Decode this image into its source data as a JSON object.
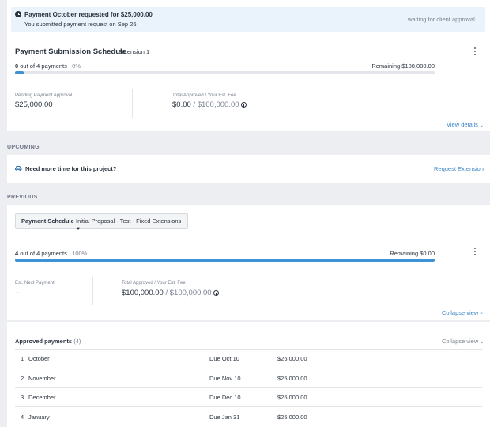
{
  "banner": {
    "title": "Payment October requested for $25,000.00",
    "subtitle": "You submitted payment request on Sep 26",
    "status": "waiting for client approval..."
  },
  "schedule": {
    "title": "Payment Submission Schedule",
    "extension": "Extension 1",
    "count_bold": "0",
    "count_rest": "out of 4 payments",
    "percent": "0%",
    "progress": 0.02,
    "remaining": "Remaining $100,000.00",
    "pending_label": "Pending Payment Approval",
    "pending_value": "$25,000.00",
    "total_label": "Total Approved / Your Est. Fee",
    "total_approved": "$0.00",
    "total_sep": "/",
    "total_fee": "$100,000.00",
    "view_details": "View details"
  },
  "upcoming": {
    "heading": "UPCOMING",
    "text": "Need more time for this project?",
    "action": "Request Extension"
  },
  "previous": {
    "heading": "PREVIOUS",
    "dropdown_label": "Payment Schedule",
    "dropdown_value": "Initial Proposal - Test - Fixed Extensions",
    "count_bold": "4",
    "count_rest": "out of 4 payments",
    "percent": "100%",
    "progress": 1.0,
    "remaining": "Remaining $0.00",
    "next_label": "Est. Next Payment",
    "next_value": "--",
    "total_label": "Total Approved / Your Est. Fee",
    "total_approved": "$100,000.00",
    "total_sep": "/",
    "total_fee": "$100,000.00",
    "collapse": "Collapse view"
  },
  "approved": {
    "title": "Approved payments",
    "count": "(4)",
    "collapse": "Collapse view",
    "rows": [
      {
        "num": "1",
        "month": "October",
        "due": "Due Oct 10",
        "amount": "$25,000.00"
      },
      {
        "num": "2",
        "month": "November",
        "due": "Due Nov 10",
        "amount": "$25,000.00"
      },
      {
        "num": "3",
        "month": "December",
        "due": "Due Dec 10",
        "amount": "$25,000.00"
      },
      {
        "num": "4",
        "month": "January",
        "due": "Due Jan 31",
        "amount": "$25,000.00"
      }
    ]
  },
  "colors": {
    "accent": "#3d93d6",
    "link": "#3a86c8",
    "banner_bg": "#eaf3fb"
  }
}
